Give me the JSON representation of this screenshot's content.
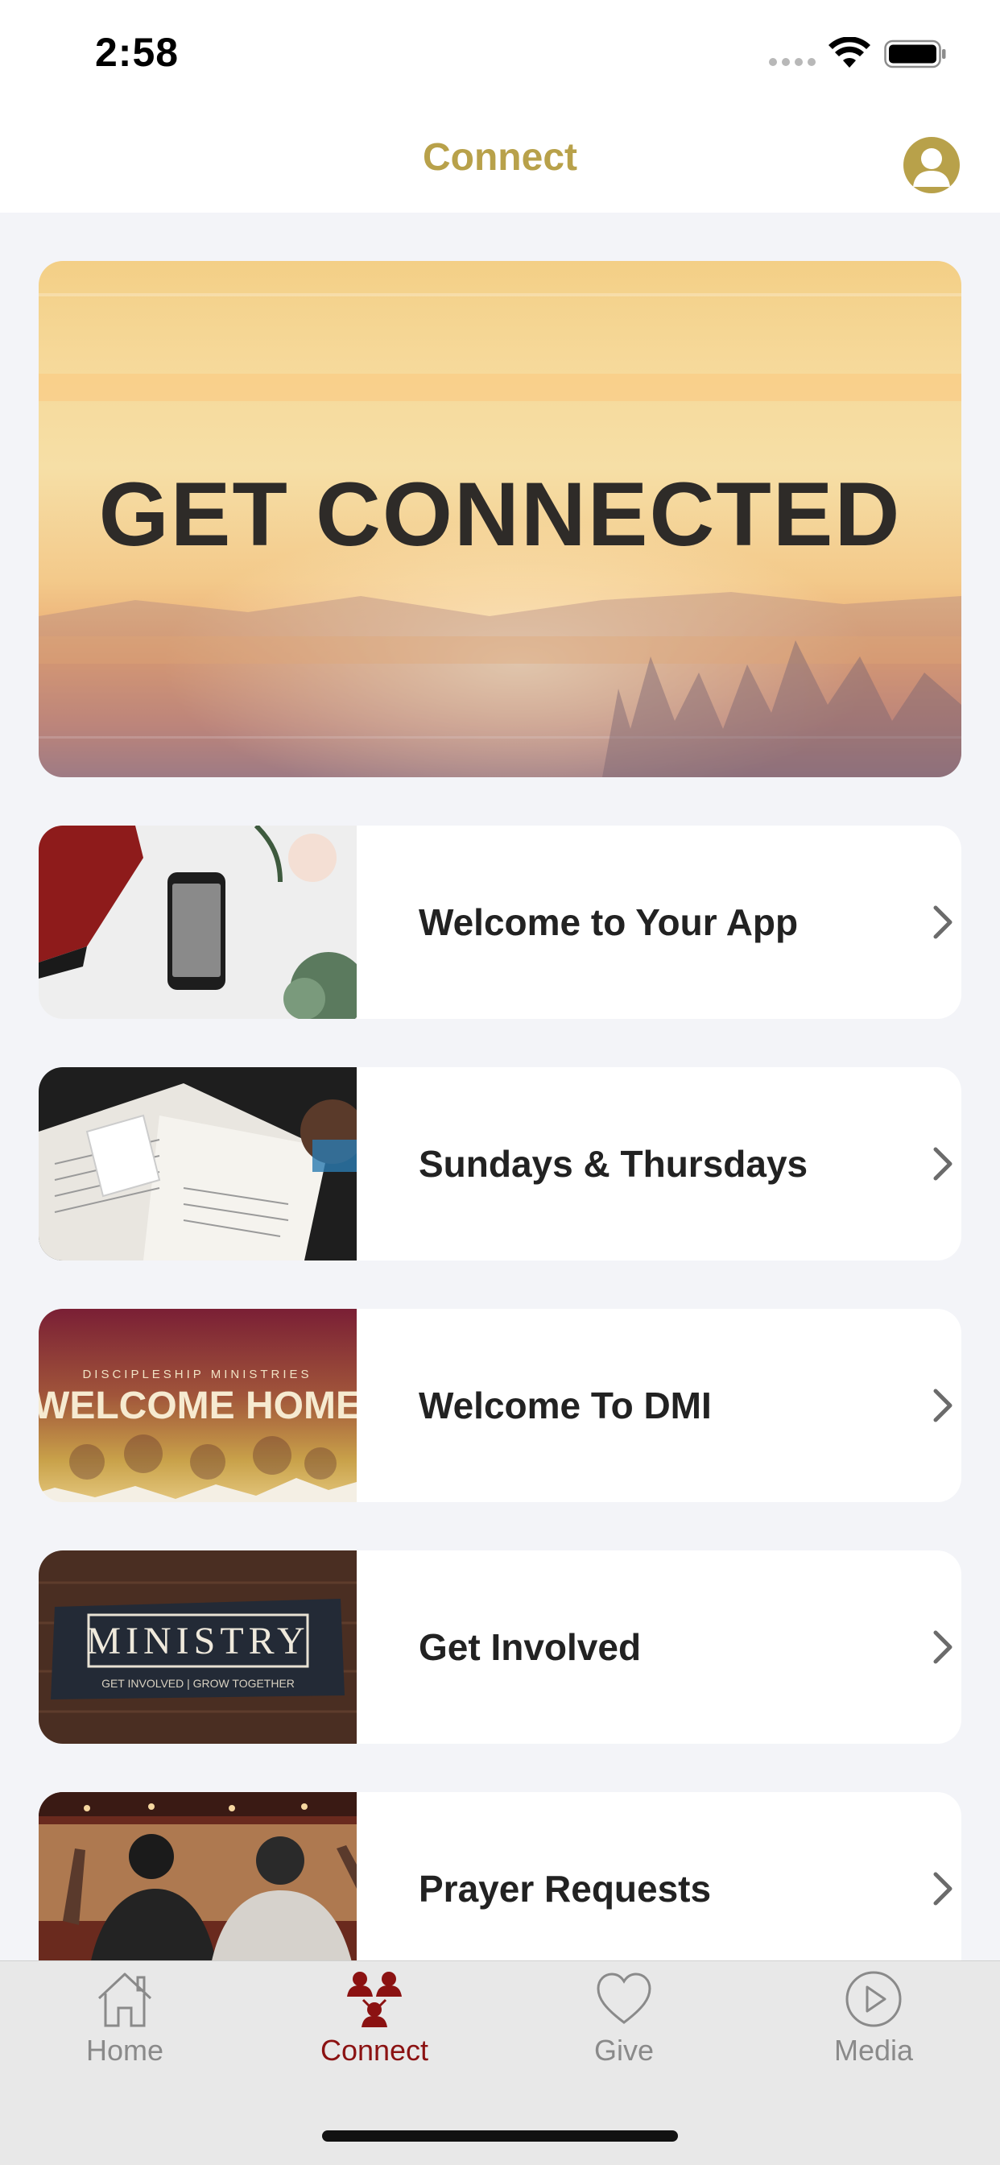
{
  "status_bar": {
    "time": "2:58"
  },
  "header": {
    "title": "Connect"
  },
  "banner": {
    "text": "GET CONNECTED"
  },
  "cards": [
    {
      "label": "Welcome to Your App",
      "thumb": "phone-on-desk-photo"
    },
    {
      "label": "Sundays & Thursdays",
      "thumb": "open-bible-notebook-photo"
    },
    {
      "label": "Welcome To DMI",
      "thumb": "welcome-home-graphic",
      "thumb_caption": "DISCIPLESHIP MINISTRIES",
      "thumb_title": "WELCOME HOME"
    },
    {
      "label": "Get Involved",
      "thumb": "ministry-graphic",
      "thumb_title": "MINISTRY",
      "thumb_caption": "GET INVOLVED | GROW TOGETHER"
    },
    {
      "label": "Prayer Requests",
      "thumb": "prayer-group-photo"
    }
  ],
  "tabs": [
    {
      "label": "Home",
      "icon": "home-icon",
      "active": false
    },
    {
      "label": "Connect",
      "icon": "connect-icon",
      "active": true
    },
    {
      "label": "Give",
      "icon": "heart-icon",
      "active": false
    },
    {
      "label": "Media",
      "icon": "play-icon",
      "active": false
    }
  ],
  "colors": {
    "accent": "#b8a14a",
    "active_tab": "#8b1212",
    "inactive_tab": "#8a8a8a",
    "background": "#f3f4f8"
  }
}
